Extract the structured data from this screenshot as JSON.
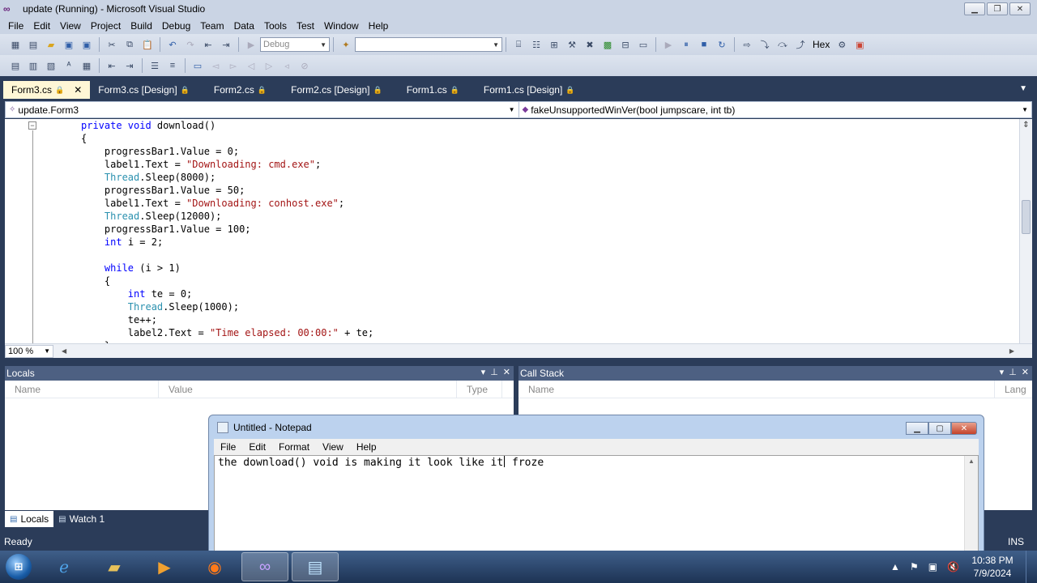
{
  "window": {
    "title": "update (Running) - Microsoft Visual Studio",
    "logo": "vs-infinity-icon"
  },
  "menu": [
    "File",
    "Edit",
    "View",
    "Project",
    "Build",
    "Debug",
    "Team",
    "Data",
    "Tools",
    "Test",
    "Window",
    "Help"
  ],
  "toolbar": {
    "config": "Debug",
    "platform": "",
    "hex": "Hex"
  },
  "tabs": [
    {
      "label": "Form3.cs",
      "active": true
    },
    {
      "label": "Form3.cs [Design]"
    },
    {
      "label": "Form2.cs"
    },
    {
      "label": "Form2.cs [Design]"
    },
    {
      "label": "Form1.cs"
    },
    {
      "label": "Form1.cs [Design]"
    }
  ],
  "nav": {
    "class": "update.Form3",
    "member": "fakeUnsupportedWinVer(bool jumpscare, int tb)"
  },
  "code": [
    [
      {
        "t": "private void ",
        "c": "kw2"
      },
      {
        "t": "download()"
      }
    ],
    [
      {
        "t": "{"
      }
    ],
    [
      {
        "t": "    progressBar1.Value = 0;"
      }
    ],
    [
      {
        "t": "    label1.Text = "
      },
      {
        "t": "\"Downloading: cmd.exe\"",
        "c": "str"
      },
      {
        "t": ";"
      }
    ],
    [
      {
        "t": "    "
      },
      {
        "t": "Thread",
        "c": "type"
      },
      {
        "t": ".Sleep(8000);"
      }
    ],
    [
      {
        "t": "    progressBar1.Value = 50;"
      }
    ],
    [
      {
        "t": "    label1.Text = "
      },
      {
        "t": "\"Downloading: conhost.exe\"",
        "c": "str"
      },
      {
        "t": ";"
      }
    ],
    [
      {
        "t": "    "
      },
      {
        "t": "Thread",
        "c": "type"
      },
      {
        "t": ".Sleep(12000);"
      }
    ],
    [
      {
        "t": "    progressBar1.Value = 100;"
      }
    ],
    [
      {
        "t": "    "
      },
      {
        "t": "int",
        "c": "kw"
      },
      {
        "t": " i = 2;"
      }
    ],
    [
      {
        "t": ""
      }
    ],
    [
      {
        "t": "    "
      },
      {
        "t": "while",
        "c": "kw"
      },
      {
        "t": " (i > 1)"
      }
    ],
    [
      {
        "t": "    {"
      }
    ],
    [
      {
        "t": "        "
      },
      {
        "t": "int",
        "c": "kw"
      },
      {
        "t": " te = 0;"
      }
    ],
    [
      {
        "t": "        "
      },
      {
        "t": "Thread",
        "c": "type"
      },
      {
        "t": ".Sleep(1000);"
      }
    ],
    [
      {
        "t": "        te++;"
      }
    ],
    [
      {
        "t": "        label2.Text = "
      },
      {
        "t": "\"Time elapsed: 00:00:\"",
        "c": "str"
      },
      {
        "t": " + te;"
      }
    ],
    [
      {
        "t": "    }"
      }
    ]
  ],
  "editor": {
    "zoom": "100 %"
  },
  "locals": {
    "title": "Locals",
    "columns": [
      "Name",
      "Value",
      "Type"
    ]
  },
  "callstack": {
    "title": "Call Stack",
    "columns": [
      "Name",
      "Lang"
    ]
  },
  "bottom_tabs": [
    {
      "label": "Locals",
      "active": true
    },
    {
      "label": "Watch 1"
    }
  ],
  "status": {
    "left": "Ready",
    "right": "INS"
  },
  "notepad": {
    "title": "Untitled - Notepad",
    "menu": [
      "File",
      "Edit",
      "Format",
      "View",
      "Help"
    ],
    "text_before_caret": "the download() void is making it look like it",
    "text_after_caret": " froze"
  },
  "taskbar": {
    "apps": [
      "internet-explorer-icon",
      "file-explorer-icon",
      "media-player-icon",
      "firefox-icon",
      "visual-studio-icon",
      "notepad-icon"
    ],
    "time": "10:38 PM",
    "date": "7/9/2024"
  }
}
